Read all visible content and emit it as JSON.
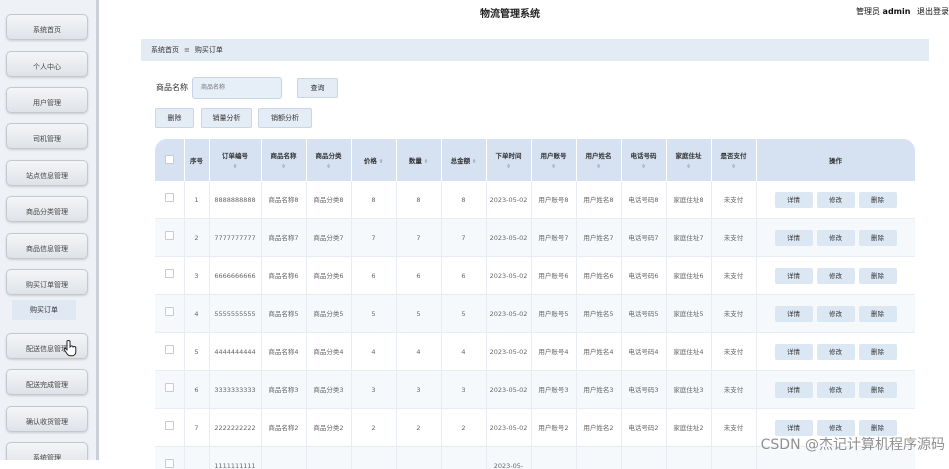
{
  "app": {
    "title": "物流管理系统",
    "user_label": "管理员",
    "user_name": "admin",
    "logout": "退出登录"
  },
  "sidebar": {
    "items": [
      {
        "label": "系统首页"
      },
      {
        "label": "个人中心"
      },
      {
        "label": "用户管理"
      },
      {
        "label": "司机管理"
      },
      {
        "label": "站点信息管理"
      },
      {
        "label": "商品分类管理"
      },
      {
        "label": "商品信息管理"
      },
      {
        "label": "购买订单管理"
      },
      {
        "label": "配送信息管理"
      },
      {
        "label": "配送完成管理"
      },
      {
        "label": "确认收货管理"
      },
      {
        "label": "系统管理"
      }
    ],
    "sub_item": "购买订单"
  },
  "breadcrumb": {
    "home": "系统首页",
    "separator": "≡",
    "current": "购买订单"
  },
  "search": {
    "label": "商品名称",
    "placeholder": "商品名称",
    "button": "查询"
  },
  "toolbar": {
    "delete": "删除",
    "sales_analysis": "销量分析",
    "amount_analysis": "销额分析"
  },
  "table": {
    "headers": {
      "index": "序号",
      "order_no": "订单编号",
      "product_name": "商品名称",
      "category": "商品分类",
      "price": "价格",
      "quantity": "数量",
      "total": "总金额",
      "order_time": "下单时间",
      "account": "用户账号",
      "user_name": "用户姓名",
      "phone": "电话号码",
      "address": "家庭住址",
      "paid": "是否支付",
      "actions": "操作"
    },
    "actions": {
      "detail": "详情",
      "edit": "修改",
      "delete": "删除"
    },
    "rows": [
      {
        "index": "1",
        "order_no": "8888888888",
        "product_name": "商品名称8",
        "category": "商品分类8",
        "price": "8",
        "quantity": "8",
        "total": "8",
        "order_time": "2023-05-02",
        "account": "用户账号8",
        "user_name": "用户姓名8",
        "phone": "电话号码8",
        "address": "家庭住址8",
        "paid": "未支付"
      },
      {
        "index": "2",
        "order_no": "7777777777",
        "product_name": "商品名称7",
        "category": "商品分类7",
        "price": "7",
        "quantity": "7",
        "total": "7",
        "order_time": "2023-05-02",
        "account": "用户账号7",
        "user_name": "用户姓名7",
        "phone": "电话号码7",
        "address": "家庭住址7",
        "paid": "未支付"
      },
      {
        "index": "3",
        "order_no": "6666666666",
        "product_name": "商品名称6",
        "category": "商品分类6",
        "price": "6",
        "quantity": "6",
        "total": "6",
        "order_time": "2023-05-02",
        "account": "用户账号6",
        "user_name": "用户姓名6",
        "phone": "电话号码6",
        "address": "家庭住址6",
        "paid": "未支付"
      },
      {
        "index": "4",
        "order_no": "5555555555",
        "product_name": "商品名称5",
        "category": "商品分类5",
        "price": "5",
        "quantity": "5",
        "total": "5",
        "order_time": "2023-05-02",
        "account": "用户账号5",
        "user_name": "用户姓名5",
        "phone": "电话号码5",
        "address": "家庭住址5",
        "paid": "未支付"
      },
      {
        "index": "5",
        "order_no": "4444444444",
        "product_name": "商品名称4",
        "category": "商品分类4",
        "price": "4",
        "quantity": "4",
        "total": "4",
        "order_time": "2023-05-02",
        "account": "用户账号4",
        "user_name": "用户姓名4",
        "phone": "电话号码4",
        "address": "家庭住址4",
        "paid": "未支付"
      },
      {
        "index": "6",
        "order_no": "3333333333",
        "product_name": "商品名称3",
        "category": "商品分类3",
        "price": "3",
        "quantity": "3",
        "total": "3",
        "order_time": "2023-05-02",
        "account": "用户账号3",
        "user_name": "用户姓名3",
        "phone": "电话号码3",
        "address": "家庭住址3",
        "paid": "未支付"
      },
      {
        "index": "7",
        "order_no": "2222222222",
        "product_name": "商品名称2",
        "category": "商品分类2",
        "price": "2",
        "quantity": "2",
        "total": "2",
        "order_time": "2023-05-02",
        "account": "用户账号2",
        "user_name": "用户姓名2",
        "phone": "电话号码2",
        "address": "家庭住址2",
        "paid": "未支付"
      },
      {
        "index": "",
        "order_no": "1111111111",
        "product_name": "",
        "category": "",
        "price": "",
        "quantity": "",
        "total": "",
        "order_time": "2023-05-",
        "account": "",
        "user_name": "",
        "phone": "",
        "address": "",
        "paid": ""
      }
    ]
  },
  "watermark": "CSDN @杰记计算机程序源码"
}
